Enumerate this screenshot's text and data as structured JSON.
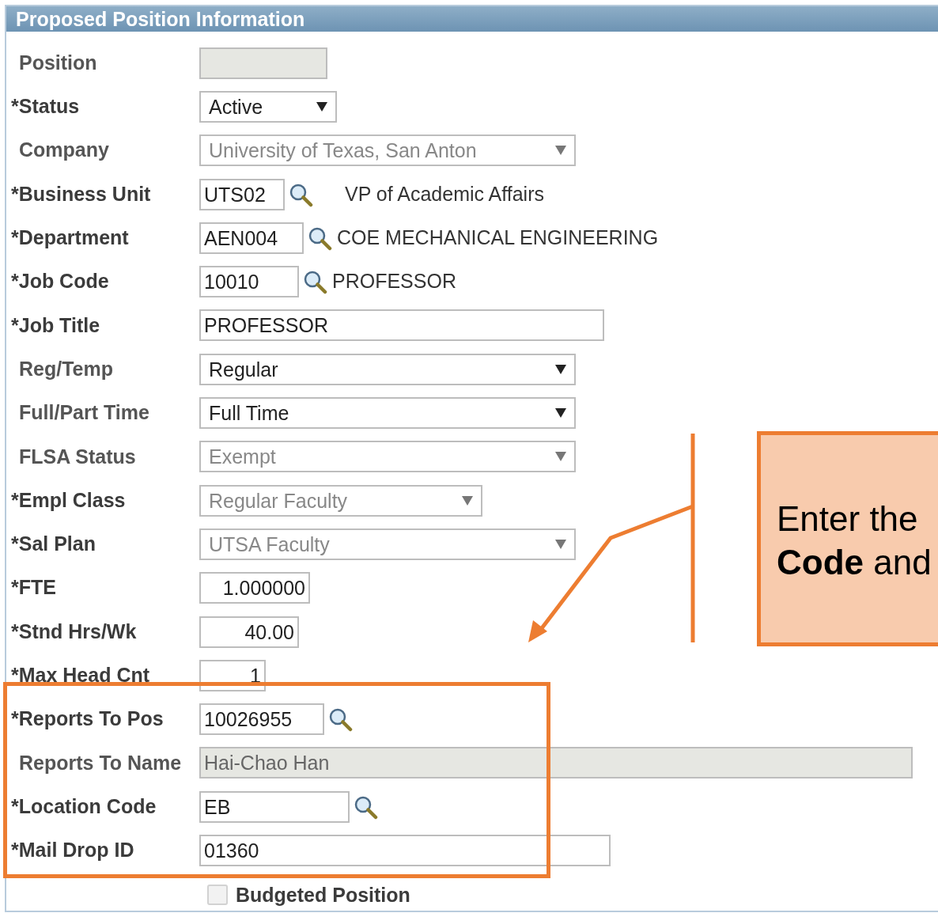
{
  "panel": {
    "title": "Proposed Position Information"
  },
  "fields": [
    {
      "label": "Position",
      "required": false,
      "kind": "readonly"
    },
    {
      "label": "*Status",
      "required": true,
      "kind": "select",
      "value": "Active",
      "disabled": false
    },
    {
      "label": "Company",
      "required": false,
      "kind": "select",
      "value": "University of Texas, San Anton",
      "disabled": true
    },
    {
      "label": "*Business Unit",
      "required": true,
      "kind": "lookup",
      "value": "UTS02",
      "description": "VP of Academic Affairs"
    },
    {
      "label": "*Department",
      "required": true,
      "kind": "lookup",
      "value": "AEN004",
      "description": "COE MECHANICAL ENGINEERING"
    },
    {
      "label": "*Job Code",
      "required": true,
      "kind": "lookup",
      "value": "10010",
      "description": "PROFESSOR"
    },
    {
      "label": "*Job Title",
      "required": true,
      "kind": "input",
      "value": "PROFESSOR"
    },
    {
      "label": "Reg/Temp",
      "required": false,
      "kind": "select",
      "value": "Regular",
      "disabled": false
    },
    {
      "label": "Full/Part Time",
      "required": false,
      "kind": "select",
      "value": "Full Time",
      "disabled": false
    },
    {
      "label": "FLSA Status",
      "required": false,
      "kind": "select",
      "value": "Exempt",
      "disabled": true
    },
    {
      "label": "*Empl Class",
      "required": true,
      "kind": "select",
      "value": "Regular Faculty",
      "disabled": true
    },
    {
      "label": "*Sal Plan",
      "required": true,
      "kind": "select",
      "value": "UTSA Faculty",
      "disabled": true
    },
    {
      "label": "*FTE",
      "required": true,
      "kind": "number",
      "value": "1.000000"
    },
    {
      "label": "*Stnd Hrs/Wk",
      "required": true,
      "kind": "number",
      "value": "40.00"
    },
    {
      "label": "*Max Head Cnt",
      "required": true,
      "kind": "number",
      "value": "1"
    },
    {
      "label": "*Reports To Pos",
      "required": true,
      "kind": "lookup",
      "value": "10026955"
    },
    {
      "label": "Reports To Name",
      "required": false,
      "kind": "readonly",
      "value": "Hai-Chao Han"
    },
    {
      "label": "*Location Code",
      "required": true,
      "kind": "lookup",
      "value": "EB"
    },
    {
      "label": "*Mail Drop ID",
      "required": true,
      "kind": "input",
      "value": "01360"
    }
  ],
  "budgeted": {
    "label": "Budgeted Position",
    "checked": false
  },
  "callout": {
    "lines": [
      "Enter the",
      "**Code** and"
    ]
  }
}
